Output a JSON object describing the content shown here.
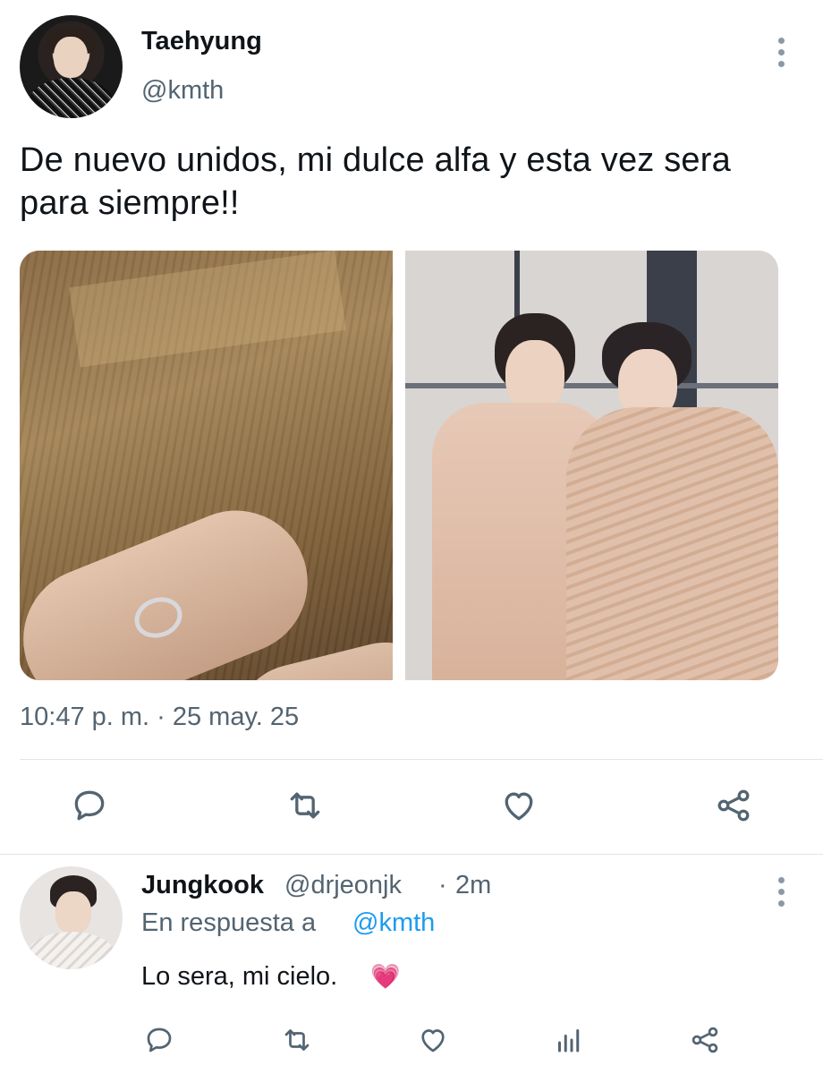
{
  "main_tweet": {
    "author_name": "Taehyung",
    "author_handle": "@kmth",
    "text": "De nuevo unidos, mi dulce alfa y esta vez sera para siempre!!",
    "timestamp": "10:47 p. m. · 25 may. 25",
    "actions": [
      "reply-icon",
      "retweet-icon",
      "like-icon",
      "share-icon"
    ]
  },
  "reply_tweet": {
    "author_name": "Jungkook",
    "author_handle": "@drjeonjk",
    "separator": "·",
    "time": "2m",
    "reply_to_label": "En respuesta a",
    "reply_to_handle": "@kmth",
    "text": "Lo sera, mi cielo.",
    "emoji": "💗",
    "actions": [
      "reply-icon",
      "retweet-icon",
      "like-icon",
      "analytics-icon",
      "share-icon"
    ]
  },
  "colors": {
    "text_primary": "#0f1419",
    "text_secondary": "#536471",
    "link": "#1d9bf0",
    "icon": "#536471",
    "divider": "#e1e6ea"
  }
}
